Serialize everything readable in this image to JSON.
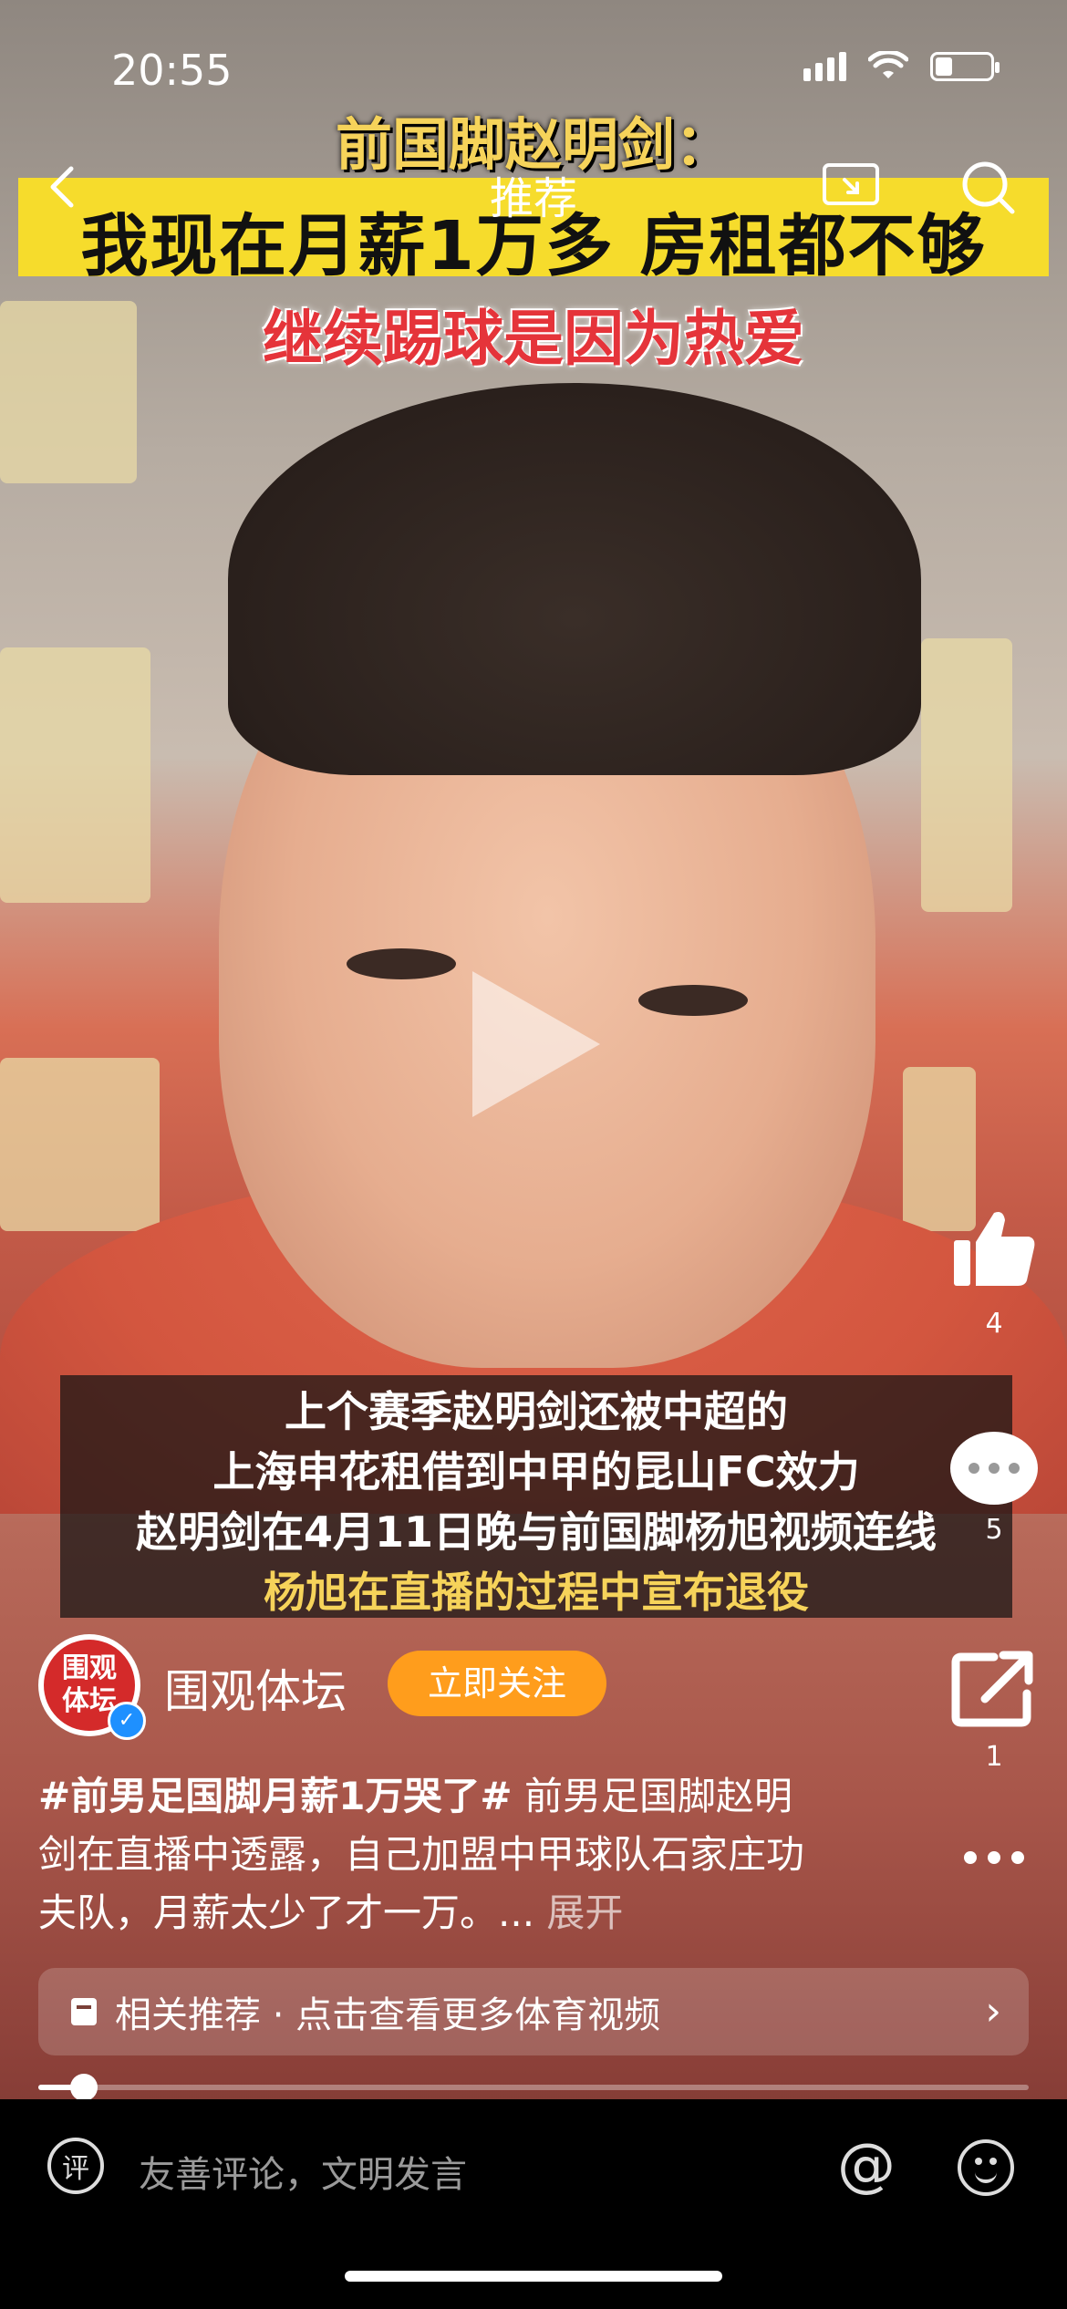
{
  "status": {
    "time": "20:55"
  },
  "nav": {
    "title": "推荐",
    "back_icon": "chevron-left-icon",
    "cast_icon": "cast-icon",
    "search_icon": "search-icon"
  },
  "video": {
    "caption_line1": "前国脚赵明剑：",
    "caption_line2": "我现在月薪1万多 房租都不够",
    "caption_line3": "继续踢球是因为热爱",
    "subtitles": [
      "上个赛季赵明剑还被中超的",
      "上海申花租借到中甲的昆山FC效力",
      "赵明剑在4月11日晚与前国脚杨旭视频连线",
      "杨旭在直播的过程中宣布退役"
    ],
    "progress": 0.046
  },
  "rail": {
    "likes": "4",
    "comments": "5",
    "shares": "1"
  },
  "account": {
    "avatar_text_line1": "围观",
    "avatar_text_line2": "体坛",
    "name": "围观体坛",
    "follow_label": "立即关注"
  },
  "description": {
    "hashtag": "#前男足国脚月薪1万哭了#",
    "text": " 前男足国脚赵明剑在直播中透露，自己加盟中甲球队石家庄功夫队，月薪太少了才一万。... ",
    "expand": "展开"
  },
  "related": {
    "label": "相关推荐 · 点击查看更多体育视频"
  },
  "bottom": {
    "comment_icon_text": "评",
    "placeholder": "友善评论，文明发言"
  },
  "colors": {
    "follow_btn": "#ff9d1c",
    "caption_bar": "#f6dc2c",
    "verified": "#1e90ff"
  }
}
